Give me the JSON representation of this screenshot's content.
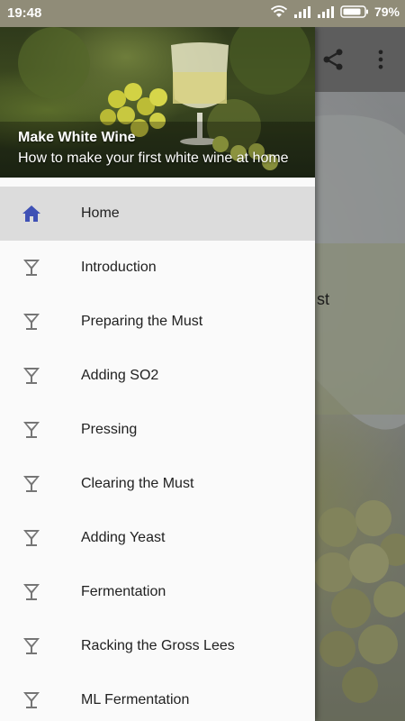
{
  "status_bar": {
    "time": "19:48",
    "battery": "79%",
    "icons": [
      "wifi-icon",
      "signal-icon",
      "signal-icon",
      "battery-icon"
    ]
  },
  "background_app": {
    "partial_text": "st",
    "toolbar_icons": [
      "share-icon",
      "more-vert-icon"
    ]
  },
  "drawer": {
    "header": {
      "title": "Make White Wine",
      "subtitle": "How to make your first white wine at home"
    },
    "items": [
      {
        "label": "Home",
        "icon": "home-icon",
        "active": true
      },
      {
        "label": "Introduction",
        "icon": "wine-glass-icon"
      },
      {
        "label": "Preparing the Must",
        "icon": "wine-glass-icon"
      },
      {
        "label": "Adding SO2",
        "icon": "wine-glass-icon"
      },
      {
        "label": "Pressing",
        "icon": "wine-glass-icon"
      },
      {
        "label": "Clearing the Must",
        "icon": "wine-glass-icon"
      },
      {
        "label": "Adding Yeast",
        "icon": "wine-glass-icon"
      },
      {
        "label": "Fermentation",
        "icon": "wine-glass-icon"
      },
      {
        "label": "Racking the Gross Lees",
        "icon": "wine-glass-icon"
      },
      {
        "label": "ML Fermentation",
        "icon": "wine-glass-icon"
      }
    ]
  },
  "colors": {
    "accent": "#3f51b5",
    "icon_gray": "#757575",
    "active_bg": "#dcdcdc"
  }
}
